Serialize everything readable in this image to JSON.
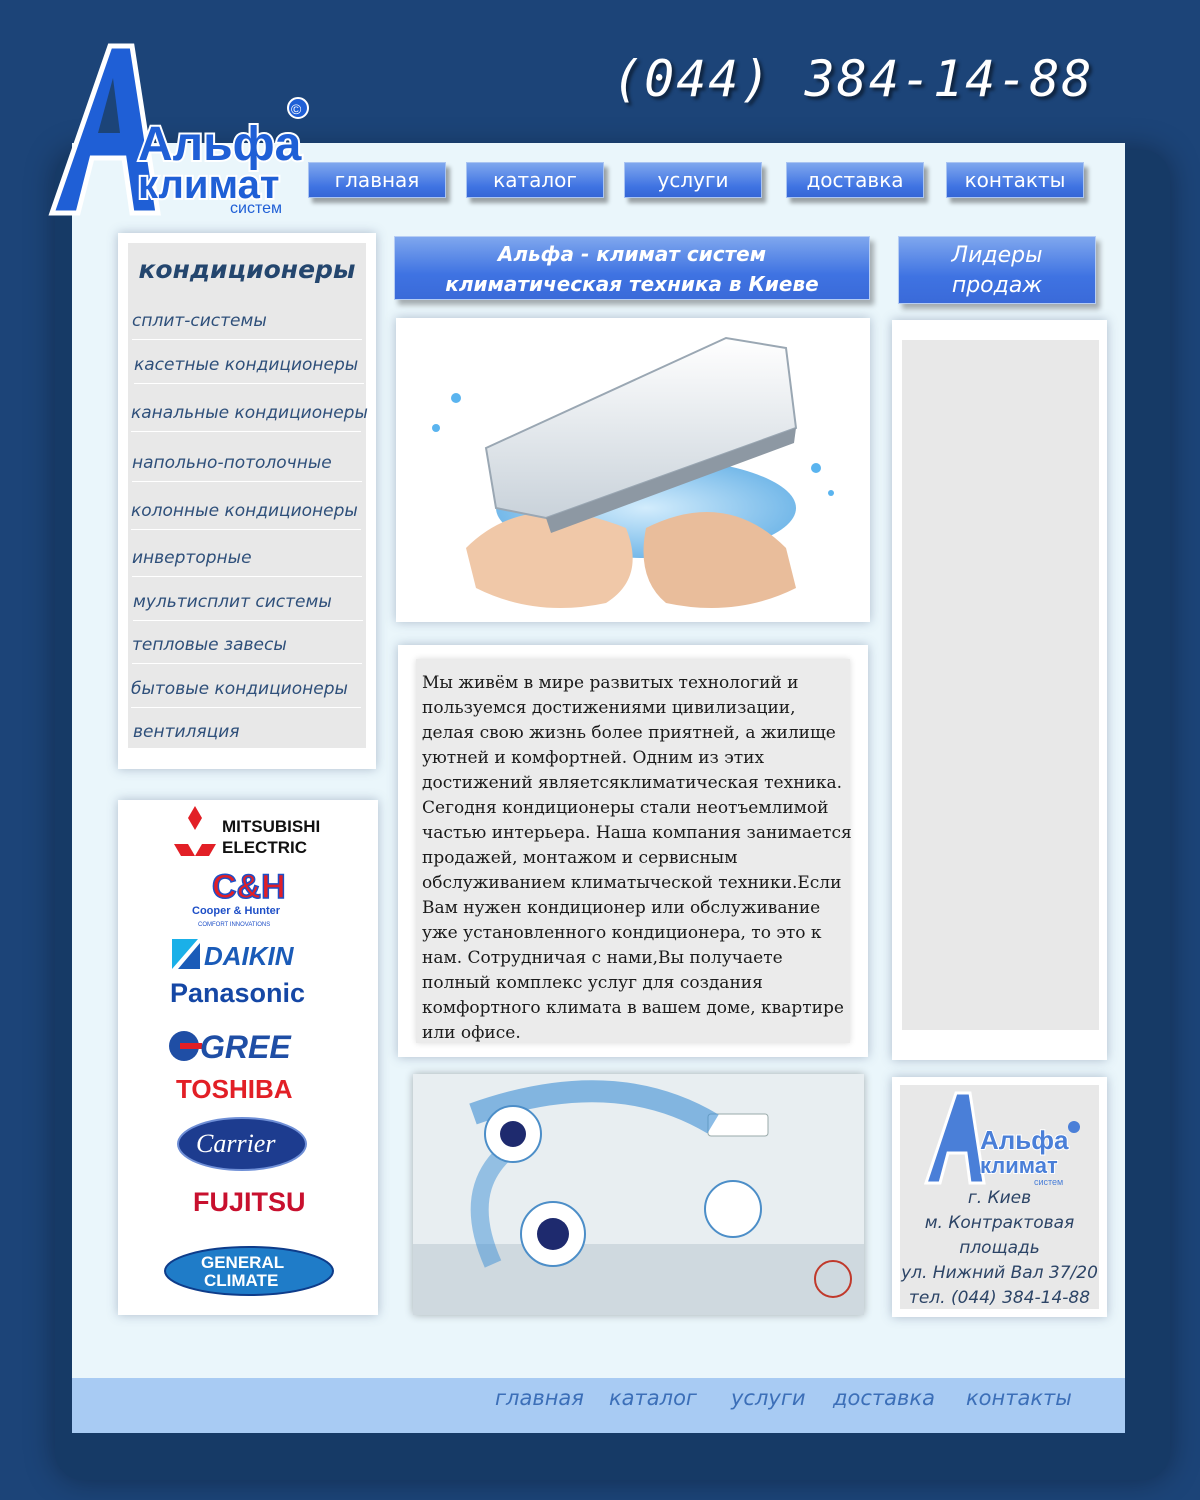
{
  "header": {
    "logo": {
      "word1": "Альфа",
      "word2": "климат",
      "word3": "систем",
      "mark": "©"
    },
    "phone": "(044) 384-14-88"
  },
  "topnav": [
    "главная",
    "каталог",
    "услуги",
    "доставка",
    "контакты"
  ],
  "categories": {
    "title": "кондиционеры",
    "items": [
      "сплит-системы",
      "касетные кондиционеры",
      "канальные кондиционеры",
      "напольно-потолочные",
      "колонные кондиционеры",
      "инверторные",
      "мультисплит системы",
      "тепловые завесы",
      "бытовые кондиционеры",
      "вентиляция"
    ]
  },
  "brands": {
    "mitsubishi": {
      "line1": "MITSUBISHI",
      "line2": "ELECTRIC"
    },
    "cooper": {
      "mark": "C&H",
      "line1": "Cooper & Hunter",
      "line2": "COMFORT INNOVATIONS"
    },
    "daikin": "DAIKIN",
    "panasonic": "Panasonic",
    "gree": "GREE",
    "toshiba": "TOSHIBA",
    "carrier": "Carrier",
    "fujitsu": "FUJITSU",
    "general": {
      "line1": "GENERAL",
      "line2": "CLIMATE"
    }
  },
  "center": {
    "heading_line1": "Альфа - климат систем",
    "heading_line2": "климатическая техника в Киеве",
    "body": "Мы живём в мире развитых технологий и пользуемся достижениями цивилизации, делая свою жизнь более приятней, а жилище уютней и комфортней. Одним из этих достижений являетсяклиматическая техника. Сегодня кондиционеры стали неотъемлимой частью интерьера. Наша компания занимается продажей, монтажом и сервисным обслуживанием климатыческой техники.Если Вам нужен кондиционер или обслуживание уже установленного кондиционера, то это к нам. Сотрудничая с нами,Вы получаете полный комплекс услуг для создания комфортного климата в вашем доме, квартире или офисе."
  },
  "right": {
    "leaders_line1": "Лидеры",
    "leaders_line2": "продаж",
    "contact": [
      "г. Киев",
      "м. Контрактовая",
      "площадь",
      "ул. Нижний Вал 37/20",
      "тел. (044) 384-14-88"
    ]
  },
  "footer": [
    "главная",
    "каталог",
    "услуги",
    "доставка",
    "контакты"
  ],
  "colors": {
    "background": "#1c4478",
    "page": "#eaf6fb",
    "button": "#3f73e2",
    "footer": "#a8cbf3"
  }
}
